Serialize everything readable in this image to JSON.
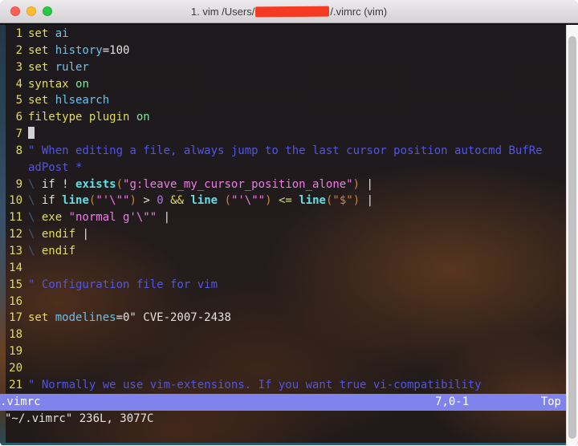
{
  "window": {
    "title_prefix": "1. vim /Users/",
    "title_suffix": "/.vimrc (vim)",
    "redaction_color": "#f23b22",
    "traffic_lights": [
      {
        "name": "close-button",
        "color": "#ff5f57"
      },
      {
        "name": "minimize-button",
        "color": "#febc2e"
      },
      {
        "name": "zoom-button",
        "color": "#28c840"
      }
    ]
  },
  "colors": {
    "yellow": "#e1dd55",
    "cyan": "#6ac1ee",
    "func": "#5ee0e4",
    "green": "#85e29e",
    "comment": "#5156e2",
    "pink": "#ee7ce4",
    "orange": "#c98440",
    "violet": "#a678e8",
    "paleyellow": "#d6d388",
    "navy": "#3b5d7a",
    "white": "#e4e2de",
    "gutter_number": "#e1dd55",
    "cursor": "#d2d1d1",
    "status_bg": "#8083ec",
    "status_text": "#ffffff",
    "cmd_text": "#e4e2de"
  },
  "editor": {
    "rows": [
      {
        "num": "1",
        "segs": [
          [
            "yellow",
            "set "
          ],
          [
            "cyan",
            "ai"
          ]
        ]
      },
      {
        "num": "2",
        "segs": [
          [
            "yellow",
            "set "
          ],
          [
            "cyan",
            "history"
          ],
          [
            "white",
            "=100"
          ]
        ]
      },
      {
        "num": "3",
        "segs": [
          [
            "yellow",
            "set "
          ],
          [
            "cyan",
            "ruler"
          ]
        ]
      },
      {
        "num": "4",
        "segs": [
          [
            "yellow",
            "syntax "
          ],
          [
            "green",
            "on"
          ]
        ]
      },
      {
        "num": "5",
        "segs": [
          [
            "yellow",
            "set "
          ],
          [
            "cyan",
            "hlsearch"
          ]
        ]
      },
      {
        "num": "6",
        "segs": [
          [
            "yellow",
            "filetype plugin "
          ],
          [
            "green",
            "on"
          ]
        ]
      },
      {
        "num": "7",
        "segs": [],
        "cursor": true
      },
      {
        "num": "8",
        "segs": [
          [
            "comment",
            "\" When editing a file, always jump to the last cursor position autocmd BufRe"
          ]
        ]
      },
      {
        "num": "",
        "segs": [
          [
            "comment",
            "adPost *"
          ]
        ]
      },
      {
        "num": "9",
        "segs": [
          [
            "navy",
            "\\ "
          ],
          [
            "white",
            "if ! "
          ],
          [
            "func",
            "exists"
          ],
          [
            "orange",
            "("
          ],
          [
            "pink",
            "\"g:leave_my_cursor_position_alone\""
          ],
          [
            "orange",
            ")"
          ],
          [
            "white",
            " |"
          ]
        ]
      },
      {
        "num": "10",
        "segs": [
          [
            "navy",
            "\\ "
          ],
          [
            "white",
            "if "
          ],
          [
            "func",
            "line"
          ],
          [
            "orange",
            "("
          ],
          [
            "pink",
            "\"'\\\"\""
          ],
          [
            "orange",
            ")"
          ],
          [
            "white",
            " > "
          ],
          [
            "violet",
            "0"
          ],
          [
            "yellow",
            " && "
          ],
          [
            "func",
            "line"
          ],
          [
            "white",
            " "
          ],
          [
            "orange",
            "("
          ],
          [
            "pink",
            "\"'\\\"\""
          ],
          [
            "orange",
            ")"
          ],
          [
            "paleyellow",
            " <= "
          ],
          [
            "func",
            "line"
          ],
          [
            "orange",
            "(\"$\")"
          ],
          [
            "white",
            " |"
          ]
        ]
      },
      {
        "num": "11",
        "segs": [
          [
            "navy",
            "\\ "
          ],
          [
            "yellow",
            "exe "
          ],
          [
            "pink",
            "\"normal g'\\\"\""
          ],
          [
            "white",
            " |"
          ]
        ]
      },
      {
        "num": "12",
        "segs": [
          [
            "navy",
            "\\ "
          ],
          [
            "yellow",
            "endif"
          ],
          [
            "white",
            " |"
          ]
        ]
      },
      {
        "num": "13",
        "segs": [
          [
            "navy",
            "\\ "
          ],
          [
            "yellow",
            "endif"
          ]
        ]
      },
      {
        "num": "14",
        "segs": []
      },
      {
        "num": "15",
        "segs": [
          [
            "comment",
            "\" Configuration file for vim"
          ]
        ]
      },
      {
        "num": "16",
        "segs": []
      },
      {
        "num": "17",
        "segs": [
          [
            "yellow",
            "set "
          ],
          [
            "cyan",
            "modelines"
          ],
          [
            "white",
            "=0\" CVE-2007-2438"
          ]
        ]
      },
      {
        "num": "18",
        "segs": []
      },
      {
        "num": "19",
        "segs": []
      },
      {
        "num": "20",
        "segs": []
      },
      {
        "num": "21",
        "segs": [
          [
            "comment",
            "\" Normally we use vim-extensions. If you want true vi-compatibility"
          ]
        ]
      }
    ],
    "statusline": {
      "file": ".vimrc",
      "ruler": "7,0-1",
      "position": "Top"
    },
    "cmdline": "\"~/.vimrc\" 236L, 3077C"
  }
}
